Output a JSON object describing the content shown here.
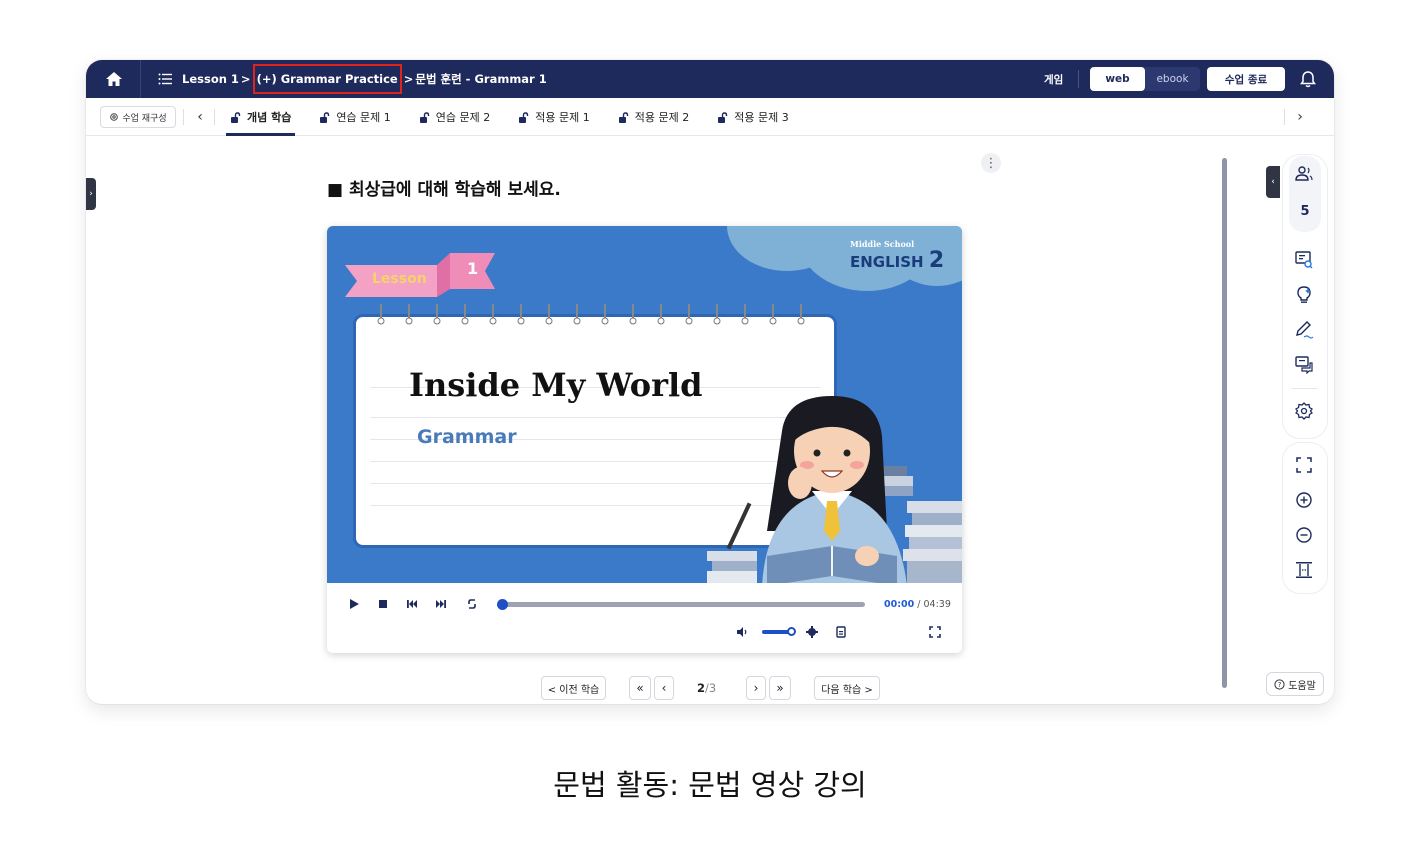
{
  "header": {
    "breadcrumb": [
      "Lesson 1",
      "(+) Grammar Practice",
      "문법 훈련 - Grammar 1"
    ],
    "breadcrumb_sep": ">",
    "game_label": "게임",
    "view_options": [
      "web",
      "ebook"
    ],
    "view_selected": "web",
    "end_class_label": "수업 종료"
  },
  "tabbar": {
    "reconfigure_label": "수업 재구성",
    "tabs": [
      "개념 학습",
      "연습 문제 1",
      "연습 문제 2",
      "적용 문제 1",
      "적용 문제 2",
      "적용 문제 3"
    ],
    "active_index": 0
  },
  "main": {
    "question": "■ 최상급에 대해 학습해 보세요.",
    "video": {
      "series_small": "Middle School",
      "series_big": "ENGLISH",
      "series_num": "2",
      "lesson_label": "Lesson",
      "lesson_num": "1",
      "title": "Inside My World",
      "subtitle": "Grammar",
      "time_current": "00:00",
      "time_total": "04:39",
      "progress_fraction": 0.0,
      "volume_fraction": 1.0
    }
  },
  "pager": {
    "prev_label": "< 이전 학습",
    "next_label": "다음 학습 >",
    "current_page": "2",
    "total_pages": "3",
    "page_sep": "/"
  },
  "right_panel": {
    "participants_count": "5",
    "help_label": "도움말"
  },
  "caption": "문법 활동: 문법 영상 강의",
  "colors": {
    "header_bg": "#1f2a5c",
    "highlight_box": "#e0241a",
    "accent_blue": "#1e5bd8",
    "video_bg": "#3a7ac9"
  },
  "icons": [
    "home-icon",
    "list-icon",
    "bell-icon",
    "gear-icon",
    "lock-open-icon",
    "more-vertical-icon",
    "play-icon",
    "stop-icon",
    "skip-back-icon",
    "skip-forward-icon",
    "repeat-icon",
    "volume-icon",
    "settings-icon",
    "subtitle-icon",
    "fullscreen-icon",
    "users-icon",
    "board-search-icon",
    "lightbulb-icon",
    "pen-icon",
    "chat-icon",
    "zoom-in-icon",
    "zoom-out-icon",
    "fit-height-icon",
    "help-circle-icon"
  ]
}
